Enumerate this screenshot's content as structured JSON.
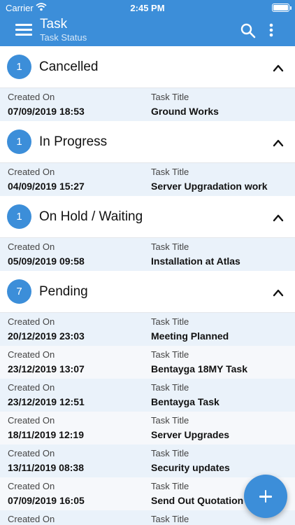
{
  "status_bar": {
    "carrier": "Carrier",
    "time": "2:45 PM"
  },
  "header": {
    "title": "Task",
    "subtitle": "Task Status"
  },
  "groups": [
    {
      "count": "1",
      "name": "Cancelled",
      "rows": [
        {
          "created_label": "Created On",
          "created_value": "07/09/2019 18:53",
          "title_label": "Task Title",
          "title_value": "Ground Works"
        }
      ]
    },
    {
      "count": "1",
      "name": "In Progress",
      "rows": [
        {
          "created_label": "Created On",
          "created_value": "04/09/2019 15:27",
          "title_label": "Task Title",
          "title_value": "Server Upgradation work"
        }
      ]
    },
    {
      "count": "1",
      "name": "On Hold / Waiting",
      "rows": [
        {
          "created_label": "Created On",
          "created_value": "05/09/2019 09:58",
          "title_label": "Task Title",
          "title_value": "Installation at Atlas"
        }
      ]
    },
    {
      "count": "7",
      "name": "Pending",
      "rows": [
        {
          "created_label": "Created On",
          "created_value": "20/12/2019 23:03",
          "title_label": "Task Title",
          "title_value": "Meeting Planned"
        },
        {
          "created_label": "Created On",
          "created_value": "23/12/2019 13:07",
          "title_label": "Task Title",
          "title_value": "Bentayga 18MY Task"
        },
        {
          "created_label": "Created On",
          "created_value": "23/12/2019 12:51",
          "title_label": "Task Title",
          "title_value": "Bentayga Task"
        },
        {
          "created_label": "Created On",
          "created_value": "18/11/2019 12:19",
          "title_label": "Task Title",
          "title_value": "Server Upgrades"
        },
        {
          "created_label": "Created On",
          "created_value": "13/11/2019 08:38",
          "title_label": "Task Title",
          "title_value": "Security updates"
        },
        {
          "created_label": "Created On",
          "created_value": "07/09/2019 16:05",
          "title_label": "Task Title",
          "title_value": "Send Out Quotation"
        },
        {
          "created_label": "Created On",
          "created_value": "",
          "title_label": "Task Title",
          "title_value": ""
        }
      ]
    }
  ],
  "icons": {
    "menu": "hamburger-menu-icon",
    "search": "search-icon",
    "more": "more-vertical-icon",
    "collapse": "chevron-up-icon",
    "add": "plus-icon"
  },
  "colors": {
    "primary": "#3c8ed9",
    "row_bg": "#f6f8fb",
    "row_alt_bg": "#eaf2fa"
  }
}
